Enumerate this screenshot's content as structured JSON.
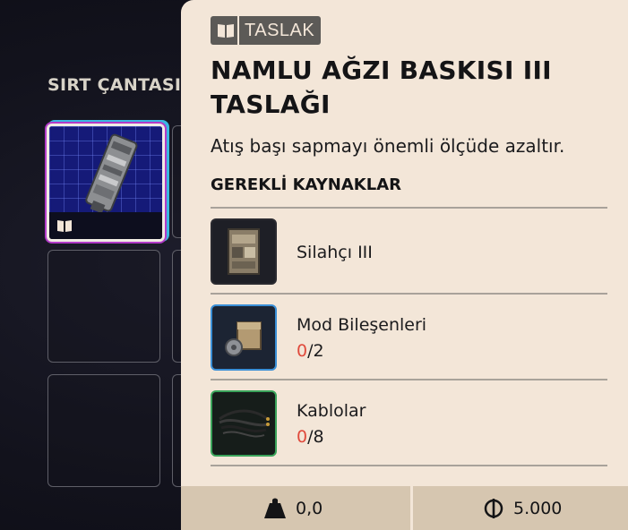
{
  "inventory": {
    "section_title": "SIRT ÇANTASI"
  },
  "tooltip": {
    "tag_label": "TASLAK",
    "title": "NAMLU AĞZI BASKISI III TASLAĞI",
    "description": "Atış başı sapmayı önemli ölçüde azaltır.",
    "requirements_title": "GEREKLİ KAYNAKLAR",
    "requirements": [
      {
        "name": "Silahçı III",
        "have": "",
        "need": "",
        "icon": "workbench-icon",
        "border_color": "#2a2a30"
      },
      {
        "name": "Mod Bileşenleri",
        "have": "0",
        "need": "/2",
        "icon": "mod-components-icon",
        "border_color": "#3a8fd6"
      },
      {
        "name": "Kablolar",
        "have": "0",
        "need": "/8",
        "icon": "cables-icon",
        "border_color": "#3aa35a"
      }
    ],
    "footer": {
      "weight": "0,0",
      "price": "5.000"
    }
  },
  "colors": {
    "tooltip_bg": "#f3e6d8",
    "footer_bg": "#d6c6b0",
    "missing_red": "#e04a3c",
    "slot_selected_bg": "#151a78"
  }
}
